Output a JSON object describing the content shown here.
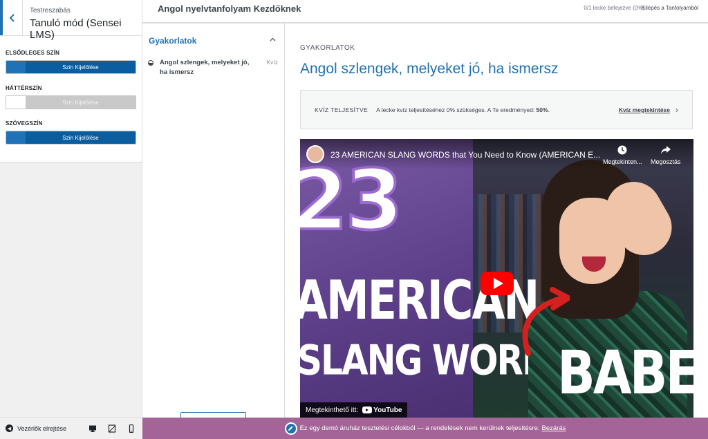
{
  "customizer": {
    "breadcrumb": "Testreszabás",
    "title": "Tanuló mód (Sensei LMS)",
    "settings": [
      {
        "label": "ELSŐDLEGES SZÍN",
        "button": "Szín Kijelölése",
        "swatch": "#1f72b8",
        "button_color": "#0a5ea0",
        "text_color": "#ffffff"
      },
      {
        "label": "HÁTTÉRSZÍN",
        "button": "Szín Kijelölése",
        "swatch": "#ffffff",
        "button_color": "#c9c9c9",
        "text_color": "#f4f4f4"
      },
      {
        "label": "SZÖVEGSZÍN",
        "button": "Szín Kijelölése",
        "swatch": "#1f72b8",
        "button_color": "#0a5ea0",
        "text_color": "#ffffff"
      }
    ],
    "hide_controls": "Vezérlők elrejtése",
    "devices": [
      "desktop-icon",
      "tablet-icon",
      "mobile-icon"
    ]
  },
  "course": {
    "title": "Angol nyelvtanfolyam Kezdőknek",
    "progress": "0/1 lecke befejezve (0%)",
    "exit_link": "Kilépés a Tanfolyamból"
  },
  "sidebar": {
    "module_title": "Gyakorlatok",
    "lessons": [
      {
        "title": "Angol szlengek, melyeket jó, ha ismersz",
        "type": "Kvíz"
      }
    ]
  },
  "lesson": {
    "eyebrow": "GYAKORLATOK",
    "title": "Angol szlengek, melyeket jó, ha ismersz",
    "quiz_notice": {
      "label": "KVÍZ TELJESÍTVE",
      "text_before": "A lecke kvíz teljesítéséhez 0% szükséges. A Te eredményed:",
      "score": "50%",
      "text_after": ".",
      "link": "Kvíz megtekintése"
    }
  },
  "video": {
    "title": "23 AMERICAN SLANG WORDS that You Need to Know (AMERICAN E...",
    "watch_later": "Megtekinten...",
    "share": "Megosztás",
    "watch_on": "Megtekinthető itt:",
    "youtube": "YouTube",
    "thumb_number": "23",
    "thumb_line1": "AMERICAN",
    "thumb_line2": "SLANG WORDS",
    "thumb_word": "BABE?"
  },
  "demo_notice": {
    "text": "Ez egy demó áruház tesztelési célokból — a rendelések nem kerülnek teljesítésre.",
    "dismiss": "Bezárás"
  },
  "colors": {
    "accent": "#2271b1",
    "demo_bar": "#a46497",
    "youtube_red": "#ff0000"
  }
}
